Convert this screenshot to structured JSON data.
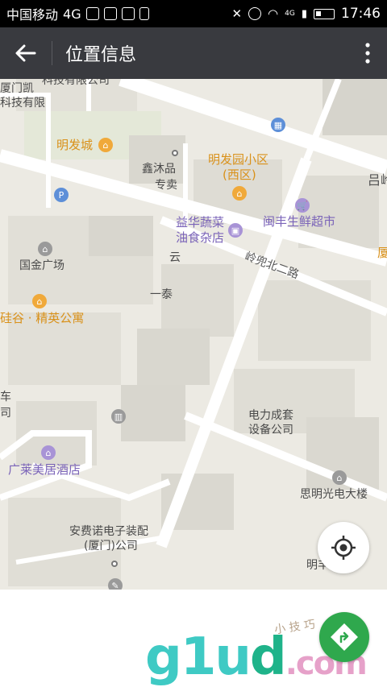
{
  "status_bar": {
    "carrier": "中国移动",
    "network": "4G",
    "network_small": "4G",
    "time": "17:46"
  },
  "app_bar": {
    "title": "位置信息"
  },
  "map": {
    "labels": [
      {
        "id": "xiamen-kai",
        "text": "厦门凯"
      },
      {
        "id": "tech-co",
        "text": "科技有限公司"
      },
      {
        "id": "tech-co-2",
        "text": "科技有限"
      },
      {
        "id": "mingfa-city",
        "text": "明发城"
      },
      {
        "id": "xinmu-1",
        "text": "鑫沐品"
      },
      {
        "id": "xinmu-2",
        "text": "专卖"
      },
      {
        "id": "mingfa-garden-1",
        "text": "明发园小区"
      },
      {
        "id": "mingfa-garden-2",
        "text": "(西区)"
      },
      {
        "id": "road-lv",
        "text": "吕岭"
      },
      {
        "id": "minfeng-market",
        "text": "闽丰生鲜超市"
      },
      {
        "id": "yihua-1",
        "text": "益华蔬菜"
      },
      {
        "id": "yihua-2",
        "text": "油食杂店"
      },
      {
        "id": "lingdou-road",
        "text": "岭兜北二路"
      },
      {
        "id": "guojin-plaza",
        "text": "国金广场"
      },
      {
        "id": "xia-edge",
        "text": "厦"
      },
      {
        "id": "yun",
        "text": "云"
      },
      {
        "id": "yitai",
        "text": "一泰"
      },
      {
        "id": "guigu-apartment",
        "text": "硅谷 · 精英公寓"
      },
      {
        "id": "che",
        "text": "车"
      },
      {
        "id": "si",
        "text": "司"
      },
      {
        "id": "power-co-1",
        "text": "电力成套"
      },
      {
        "id": "power-co-2",
        "text": "设备公司"
      },
      {
        "id": "guanglai-hotel",
        "text": "广莱美居酒店"
      },
      {
        "id": "siming-building",
        "text": "思明光电大楼"
      },
      {
        "id": "anfeinuo-1",
        "text": "安费诺电子装配"
      },
      {
        "id": "anfeinuo-2",
        "text": "(厦门)公司"
      },
      {
        "id": "mingfeng-center",
        "text": "明丰中心"
      }
    ]
  },
  "watermark": {
    "g": "g",
    "lu": "1u",
    "d": "d",
    "com": ".com",
    "sub": "小 技 巧"
  },
  "colors": {
    "app_bar": "#393a3f",
    "map_bg": "#eceae3",
    "road": "#ffffff",
    "poi_orange": "#f0a93a",
    "poi_purple": "#a893d6",
    "nav_green": "#2fa84d"
  },
  "icons": [
    "back-arrow-icon",
    "more-vert-icon",
    "locate-icon",
    "navigation-icon",
    "parking-icon",
    "metro-icon",
    "shopping-cart-icon"
  ]
}
